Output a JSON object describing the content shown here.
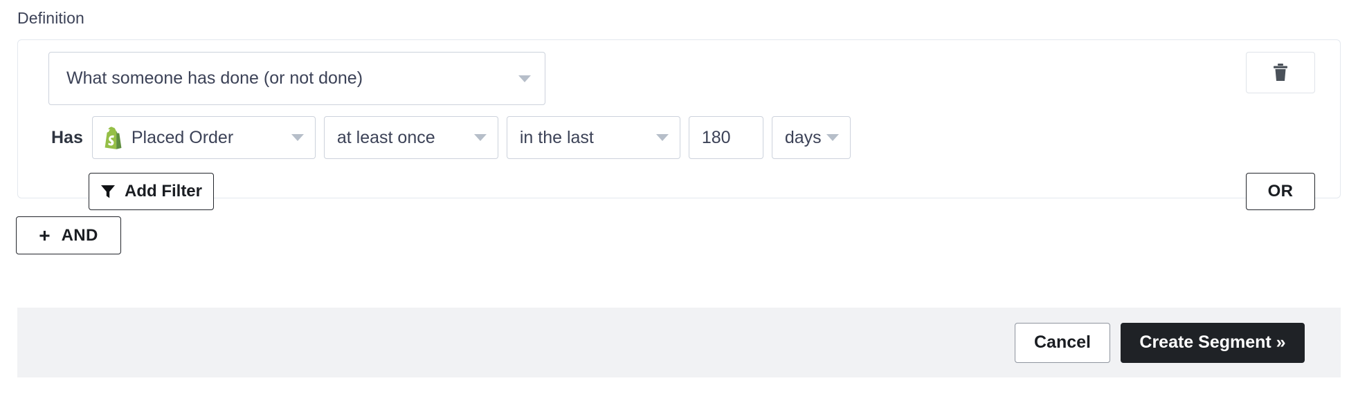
{
  "section": {
    "label": "Definition"
  },
  "condition": {
    "type_value": "What someone has done (or not done)",
    "has_label": "Has",
    "metric": {
      "icon": "shopify-icon",
      "value": "Placed Order"
    },
    "operator": {
      "value": "at least once"
    },
    "timeframe": {
      "value": "in the last"
    },
    "amount": {
      "value": "180"
    },
    "unit": {
      "value": "days"
    },
    "add_filter_label": "Add Filter",
    "or_label": "OR",
    "delete_icon": "trash-icon"
  },
  "and_button": {
    "plus": "+",
    "label": "AND"
  },
  "footer": {
    "cancel_label": "Cancel",
    "create_label": "Create Segment »"
  },
  "colors": {
    "panel_border": "#e3e8ee",
    "field_border": "#ccd2dc",
    "text": "#3c4257",
    "dark_button": "#1f2226",
    "footer_bg": "#f1f2f4",
    "shopify_green": "#95bf47",
    "shopify_green_dark": "#7ba339",
    "caret_gray": "#b6bec9"
  }
}
